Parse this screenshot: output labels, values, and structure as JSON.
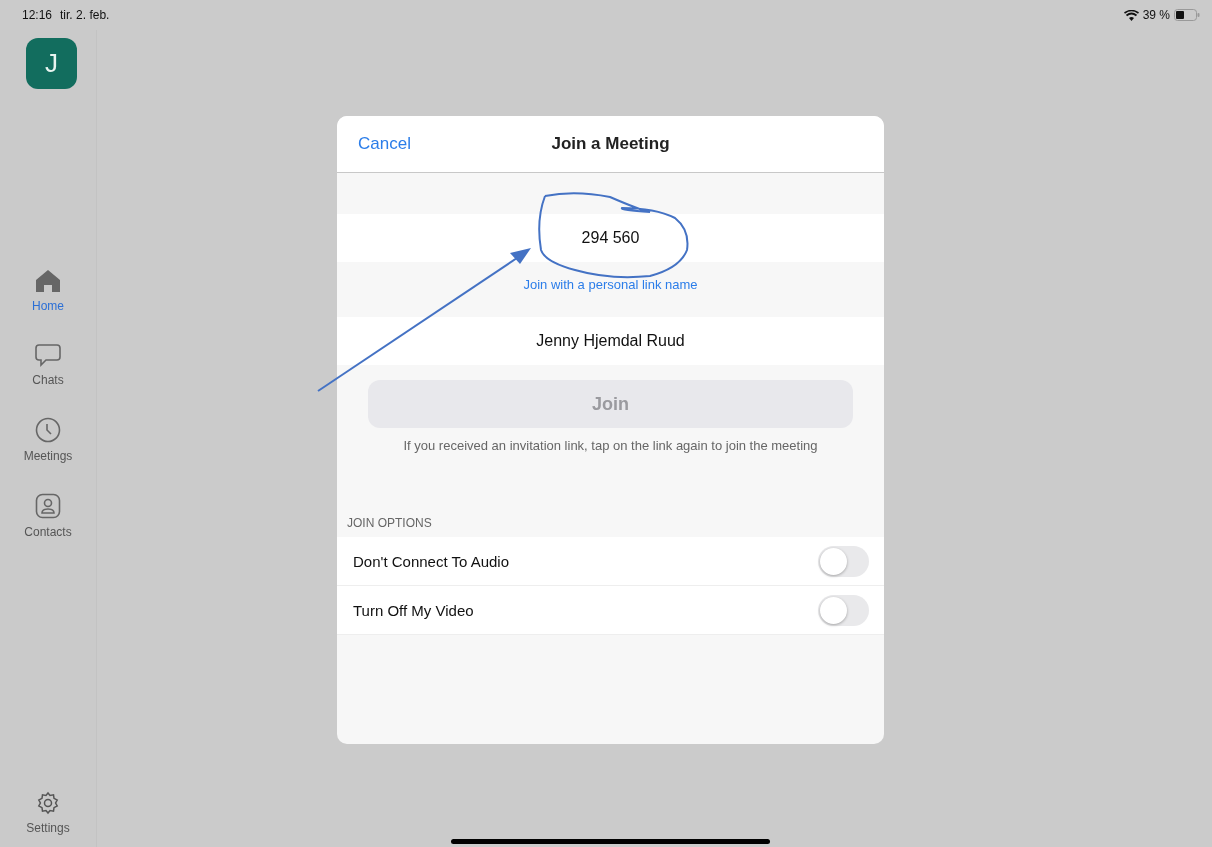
{
  "status_bar": {
    "time": "12:16",
    "date": "tir. 2. feb.",
    "battery": "39 %"
  },
  "sidebar": {
    "avatar": "J",
    "items": [
      {
        "label": "Home",
        "kind": "home",
        "selected": true
      },
      {
        "label": "Chats",
        "kind": "chat",
        "selected": false
      },
      {
        "label": "Meetings",
        "kind": "meetings",
        "selected": false
      },
      {
        "label": "Contacts",
        "kind": "contacts",
        "selected": false
      }
    ],
    "settings": {
      "label": "Settings",
      "kind": "settings",
      "selected": false
    }
  },
  "dialog": {
    "cancel": "Cancel",
    "title": "Join a Meeting",
    "meeting_id": "294 560",
    "personal_link": "Join with a personal link name",
    "name": "Jenny Hjemdal Ruud",
    "join_button": {
      "label": "Join",
      "disabled": true
    },
    "hint": "If you received an invitation link, tap on the link again to join the meeting",
    "options_heading": "JOIN OPTIONS",
    "options": [
      {
        "label": "Don't Connect To Audio",
        "on": false
      },
      {
        "label": "Turn Off My Video",
        "on": false
      }
    ]
  }
}
